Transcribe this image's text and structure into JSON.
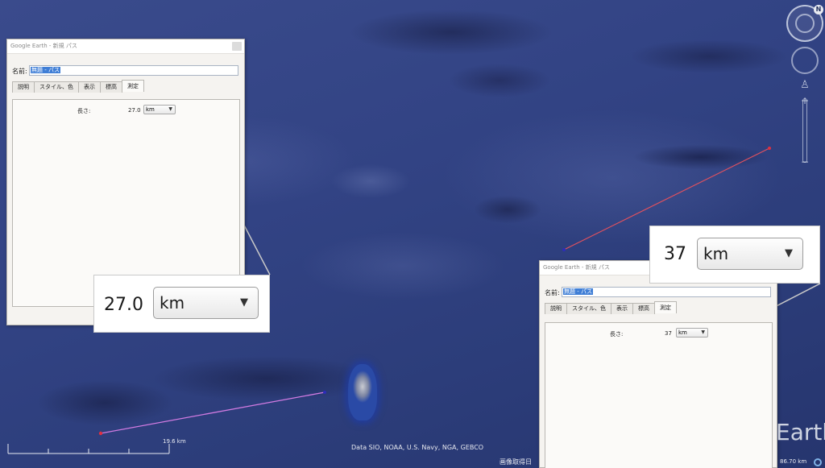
{
  "map": {
    "attribution": "Data SIO, NOAA, U.S. Navy, NGA, GEBCO",
    "scale_label": "19.6 km",
    "imagery_date_label": "画像取得日",
    "eye_alt": "86.70 km",
    "logo_text": "Earth",
    "compass_letter": "N",
    "path_colors": {
      "upper": "#e0515f",
      "lower": "#d27be2"
    }
  },
  "dialog_left": {
    "title": "Google Earth - 新規 パス",
    "name_label": "名前:",
    "name_value": "無題 - パス",
    "tabs": [
      "説明",
      "スタイル、色",
      "表示",
      "標高",
      "測定"
    ],
    "active_tab": "測定",
    "length_label": "長さ:",
    "length_value": "27.0",
    "unit": "km"
  },
  "dialog_right": {
    "title": "Google Earth - 新規 パス",
    "name_label": "名前:",
    "name_value": "無題 - パス",
    "tabs": [
      "説明",
      "スタイル、色",
      "表示",
      "標高",
      "測定"
    ],
    "active_tab": "測定",
    "length_label": "長さ:",
    "length_value": "37",
    "unit": "km"
  },
  "callout_left": {
    "value": "27.0",
    "unit": "km"
  },
  "callout_right": {
    "value": "37",
    "unit": "km"
  },
  "icons": {
    "compass": "compass-icon",
    "look": "look-ring-icon",
    "street_view": "person-icon",
    "zoom": "zoom-slider-icon",
    "dropdown": "chevron-down-icon"
  }
}
